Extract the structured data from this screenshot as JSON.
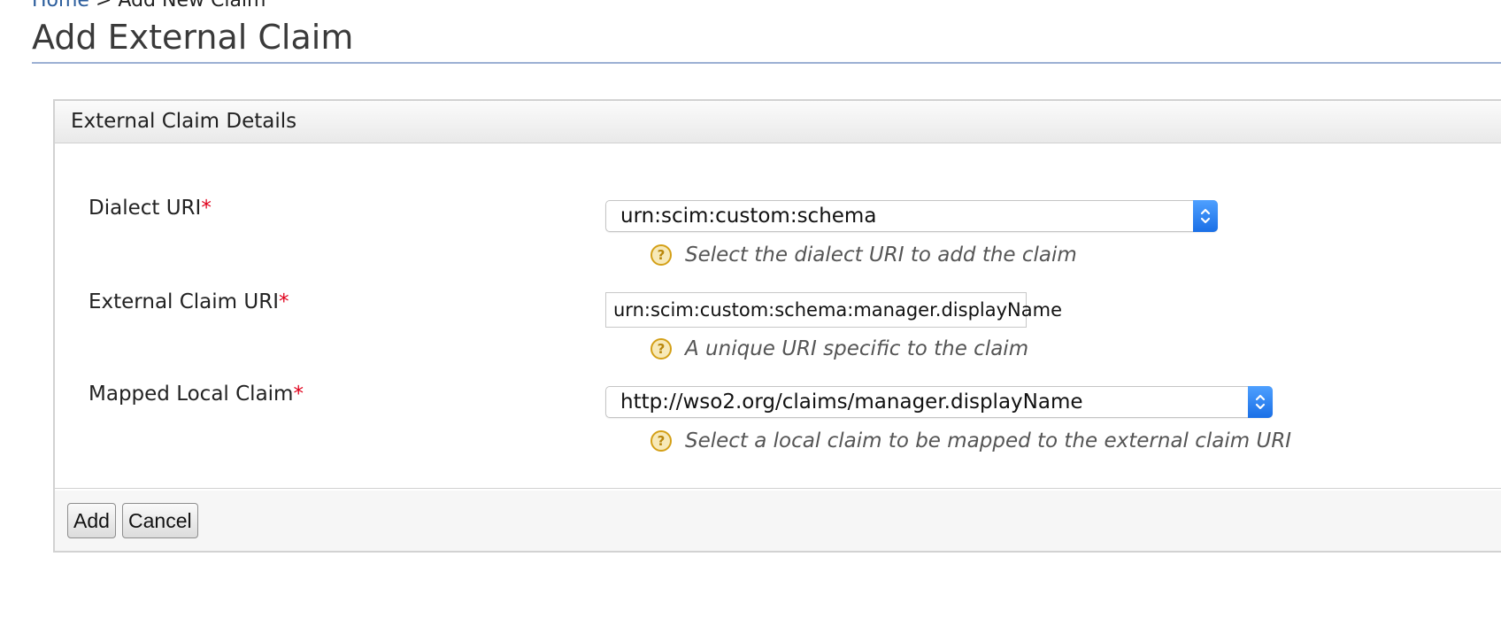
{
  "breadcrumb": {
    "home": "Home",
    "separator": ">",
    "current": "Add New Claim"
  },
  "page_title": "Add External Claim",
  "panel": {
    "header": "External Claim Details",
    "fields": {
      "dialect": {
        "label": "Dialect URI",
        "required_mark": "*",
        "selected": "urn:scim:custom:schema",
        "help": "Select the dialect URI to add the claim"
      },
      "external_claim": {
        "label": "External Claim URI",
        "required_mark": "*",
        "value": "urn:scim:custom:schema:manager.displayName",
        "help": "A unique URI specific to the claim"
      },
      "mapped_local": {
        "label": "Mapped Local Claim",
        "required_mark": "*",
        "selected": "http://wso2.org/claims/manager.displayName",
        "help": "Select a local claim to be mapped to the external claim URI"
      }
    },
    "buttons": {
      "add": "Add",
      "cancel": "Cancel"
    }
  },
  "icons": {
    "help": "question-help-icon",
    "select": "chevron-updown-icon"
  },
  "colors": {
    "accent": "#1a6fe6",
    "required": "#e0001b",
    "help_icon": "#d4a017",
    "title_rule": "#9cb0d3"
  }
}
